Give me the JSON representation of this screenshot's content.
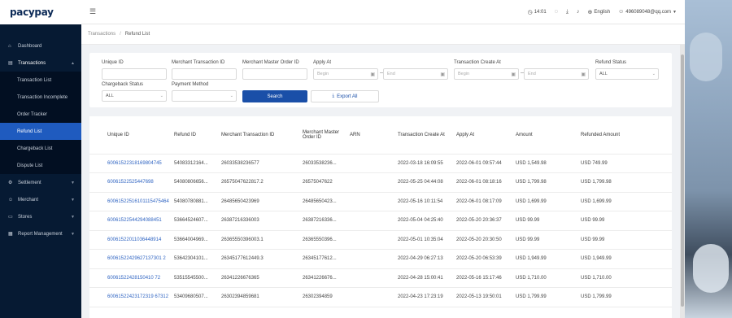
{
  "app": {
    "logo": "pacypay"
  },
  "header": {
    "time": "14:01",
    "language": "English",
    "user": "496089048@qq.com"
  },
  "sidebar": {
    "items": [
      {
        "label": "Dashboard"
      },
      {
        "label": "Transactions"
      },
      {
        "label": "Settlement"
      },
      {
        "label": "Merchant"
      },
      {
        "label": "Stores"
      },
      {
        "label": "Report Management"
      }
    ],
    "subitems": [
      {
        "label": "Transaction List"
      },
      {
        "label": "Transaction Incomplete"
      },
      {
        "label": "Order Tracker"
      },
      {
        "label": "Refund List"
      },
      {
        "label": "Chargeback List"
      },
      {
        "label": "Dispute List"
      }
    ]
  },
  "breadcrumb": {
    "parent": "Transactions",
    "sep": "/",
    "current": "Refund List"
  },
  "filters": {
    "unique_id": "Unique ID",
    "merchant_txn_id": "Merchant Transaction ID",
    "merchant_master_order_id": "Merchant Master Order ID",
    "apply_at": "Apply At",
    "apply_begin": "Begin",
    "apply_end": "End",
    "txn_create_at": "Transaction Create At",
    "create_begin": "Begin",
    "create_end": "End",
    "refund_status": "Refund Status",
    "refund_status_value": "ALL",
    "chargeback_status": "Chargeback Status",
    "chargeback_status_value": "ALL",
    "payment_method": "Payment Method",
    "search": "Search",
    "export": "Export All"
  },
  "table": {
    "columns": [
      "Unique ID",
      "Refund ID",
      "Merchant Transaction ID",
      "Merchant Master Order ID",
      "ARN",
      "Transaction Create At",
      "Apply At",
      "Amount",
      "Refunded Amount"
    ],
    "rows": [
      [
        "60061522318169804745",
        "54083312164...",
        "26033538236577",
        "26033538236...",
        "",
        "2022-03-18 16:09:55",
        "2022-06-01 09:57:44",
        "USD 1,549.98",
        "USD 749.99"
      ],
      [
        "60061522525447698",
        "54080806656...",
        "26575047622817.2",
        "26575047622",
        "",
        "2022-05-25 04:44:08",
        "2022-06-01 08:18:16",
        "USD 1,799.98",
        "USD 1,799.98"
      ],
      [
        "60061522516101115475464",
        "54080780881...",
        "26485650423969",
        "26485650423...",
        "",
        "2022-05-16 10:11:54",
        "2022-06-01 08:17:09",
        "USD 1,699.99",
        "USD 1,699.99"
      ],
      [
        "60061522544294088451",
        "53664524607...",
        "26387216336003",
        "26387216336...",
        "",
        "2022-05-04 04:25:40",
        "2022-05-20 20:36:37",
        "USD 99.99",
        "USD 99.99"
      ],
      [
        "60061522011036448914",
        "53664004969...",
        "26365550396003.1",
        "26365550396...",
        "",
        "2022-05-01 10:35:04",
        "2022-05-20 20:30:50",
        "USD 99.99",
        "USD 99.99"
      ],
      [
        "60061522429627137301 2",
        "53642304101...",
        "26345177612449.3",
        "26345177612...",
        "",
        "2022-04-29 06:27:13",
        "2022-05-20 06:53:39",
        "USD 1,949.99",
        "USD 1,949.99"
      ],
      [
        "60061522428150410 72",
        "53515545500...",
        "26341226676365",
        "26341226676...",
        "",
        "2022-04-28 15:00:41",
        "2022-05-16 15:17:46",
        "USD 1,710.00",
        "USD 1,710.00"
      ],
      [
        "60061522423172319 67312",
        "53409680507...",
        "26302394859681",
        "26302394859",
        "",
        "2022-04-23 17:23:19",
        "2022-05-13 19:50:01",
        "USD 1,799.99",
        "USD 1,799.99"
      ]
    ]
  }
}
